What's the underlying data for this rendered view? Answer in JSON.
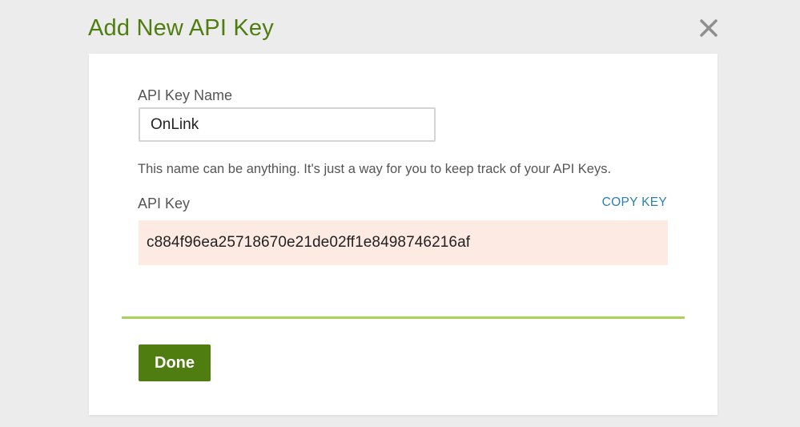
{
  "dialog": {
    "title": "Add New API Key",
    "close_icon": "close-icon"
  },
  "form": {
    "name_label": "API Key Name",
    "name_value": "OnLink",
    "hint": "This name can be anything. It's just a way for you to keep track of your API Keys.",
    "key_label": "API Key",
    "copy_label": "COPY KEY",
    "key_value": "c884f96ea25718670e21de02ff1e8498746216af"
  },
  "actions": {
    "done_label": "Done"
  },
  "colors": {
    "accent": "#4f7d0f",
    "divider": "#a8d25a",
    "key_background": "#fdeae3",
    "link": "#2c7fad"
  }
}
